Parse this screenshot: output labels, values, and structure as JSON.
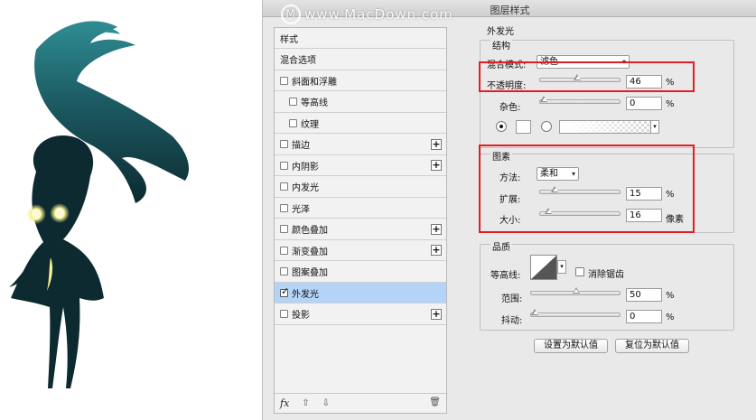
{
  "watermark": {
    "text": "www.MacDown.com"
  },
  "dialog": {
    "title": "图层样式"
  },
  "styles_list": {
    "items": [
      {
        "label": "样式",
        "checkbox": false,
        "checked": false,
        "plus": false,
        "indent": false,
        "selected": false
      },
      {
        "label": "混合选项",
        "checkbox": false,
        "checked": false,
        "plus": false,
        "indent": false,
        "selected": false
      },
      {
        "label": "斜面和浮雕",
        "checkbox": true,
        "checked": false,
        "plus": false,
        "indent": false,
        "selected": false
      },
      {
        "label": "等高线",
        "checkbox": true,
        "checked": false,
        "plus": false,
        "indent": true,
        "selected": false
      },
      {
        "label": "纹理",
        "checkbox": true,
        "checked": false,
        "plus": false,
        "indent": true,
        "selected": false
      },
      {
        "label": "描边",
        "checkbox": true,
        "checked": false,
        "plus": true,
        "indent": false,
        "selected": false
      },
      {
        "label": "内阴影",
        "checkbox": true,
        "checked": false,
        "plus": true,
        "indent": false,
        "selected": false
      },
      {
        "label": "内发光",
        "checkbox": true,
        "checked": false,
        "plus": false,
        "indent": false,
        "selected": false
      },
      {
        "label": "光泽",
        "checkbox": true,
        "checked": false,
        "plus": false,
        "indent": false,
        "selected": false
      },
      {
        "label": "颜色叠加",
        "checkbox": true,
        "checked": false,
        "plus": true,
        "indent": false,
        "selected": false
      },
      {
        "label": "渐变叠加",
        "checkbox": true,
        "checked": false,
        "plus": true,
        "indent": false,
        "selected": false
      },
      {
        "label": "图案叠加",
        "checkbox": true,
        "checked": false,
        "plus": false,
        "indent": false,
        "selected": false
      },
      {
        "label": "外发光",
        "checkbox": true,
        "checked": true,
        "plus": false,
        "indent": false,
        "selected": true
      },
      {
        "label": "投影",
        "checkbox": true,
        "checked": false,
        "plus": true,
        "indent": false,
        "selected": false
      }
    ],
    "footer": {
      "fx": "fx",
      "up_icon": "move-up-icon",
      "down_icon": "move-down-icon",
      "trash_icon": "trash-icon"
    }
  },
  "outer_glow": {
    "heading": "外发光",
    "structure": {
      "legend": "结构",
      "blend_mode_label": "混合模式:",
      "blend_mode_value": "滤色",
      "opacity_label": "不透明度:",
      "opacity_value": "46",
      "opacity_unit": "%",
      "opacity_fraction": 0.46,
      "noise_label": "杂色:",
      "noise_value": "0",
      "noise_unit": "%",
      "noise_fraction": 0.0,
      "color_swatch": "#ffffff"
    },
    "elements": {
      "legend": "图素",
      "method_label": "方法:",
      "method_value": "柔和",
      "spread_label": "扩展:",
      "spread_value": "15",
      "spread_unit": "%",
      "spread_fraction": 0.15,
      "size_label": "大小:",
      "size_value": "16",
      "size_unit": "像素",
      "size_fraction": 0.065
    },
    "quality": {
      "legend": "品质",
      "contour_label": "等高线:",
      "antialias_label": "消除锯齿",
      "range_label": "范围:",
      "range_value": "50",
      "range_unit": "%",
      "range_fraction": 0.5,
      "jitter_label": "抖动:",
      "jitter_value": "0",
      "jitter_unit": "%",
      "jitter_fraction": 0.0
    },
    "buttons": {
      "make_default": "设置为默认值",
      "reset_default": "复位为默认值"
    }
  },
  "colors": {
    "highlight_box": "#e11d25",
    "selected_row": "#b4d4f7",
    "figure_dark": "#0c2a2f",
    "figure_teal": "#2f8d93",
    "eye_glow": "#f6f08a"
  }
}
